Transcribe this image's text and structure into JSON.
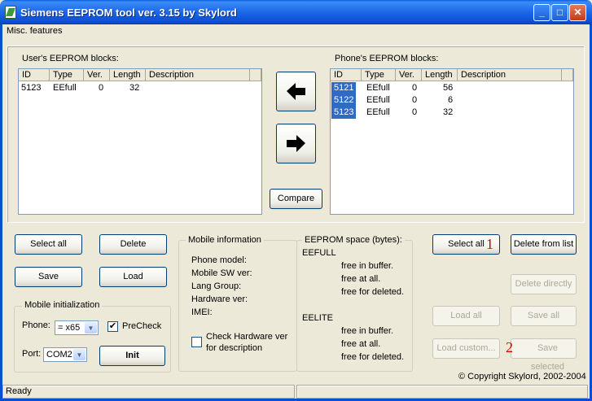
{
  "window": {
    "title": "Siemens EEPROM tool ver. 3.15 by Skylord"
  },
  "menu": {
    "misc": "Misc. features"
  },
  "user_list": {
    "label": "User's EEPROM blocks:",
    "columns": [
      "ID",
      "Type",
      "Ver.",
      "Length",
      "Description"
    ],
    "rows": [
      {
        "id": "5123",
        "type": "EEfull",
        "ver": "0",
        "length": "32",
        "desc": ""
      }
    ]
  },
  "phone_list": {
    "label": "Phone's EEPROM blocks:",
    "columns": [
      "ID",
      "Type",
      "Ver.",
      "Length",
      "Description"
    ],
    "rows": [
      {
        "id": "5121",
        "type": "EEfull",
        "ver": "0",
        "length": "56",
        "desc": ""
      },
      {
        "id": "5122",
        "type": "EEfull",
        "ver": "0",
        "length": "6",
        "desc": ""
      },
      {
        "id": "5123",
        "type": "EEfull",
        "ver": "0",
        "length": "32",
        "desc": ""
      }
    ]
  },
  "buttons": {
    "compare": "Compare",
    "select_all_left": "Select all",
    "delete": "Delete",
    "save": "Save",
    "load": "Load",
    "init": "Init",
    "select_all_right": "Select all",
    "delete_from_list": "Delete from list",
    "delete_directly": "Delete directly",
    "load_all": "Load all",
    "save_all": "Save all",
    "load_custom": "Load custom...",
    "save_selected": "Save selected"
  },
  "mobile_init": {
    "title": "Mobile initialization",
    "phone_label": "Phone:",
    "phone_value": "= x65",
    "precheck": "PreCheck",
    "port_label": "Port:",
    "port_value": "COM2"
  },
  "mobile_info": {
    "title": "Mobile information",
    "lines": [
      "Phone model:",
      "Mobile SW ver:",
      "Lang Group:",
      "Hardware ver:",
      "IMEI:"
    ],
    "check_hw_1": "Check Hardware ver",
    "check_hw_2": "for description"
  },
  "eeprom_space": {
    "title": "EEPROM space (bytes):",
    "eefull": "EEFULL",
    "eelite": "EELITE",
    "free_buffer": "free in buffer.",
    "free_all": "free at all.",
    "free_deleted": "free for deleted."
  },
  "annotations": {
    "one": "1",
    "two": "2"
  },
  "copyright": "© Copyright Skylord, 2002-2004",
  "status": {
    "text": "Ready"
  }
}
